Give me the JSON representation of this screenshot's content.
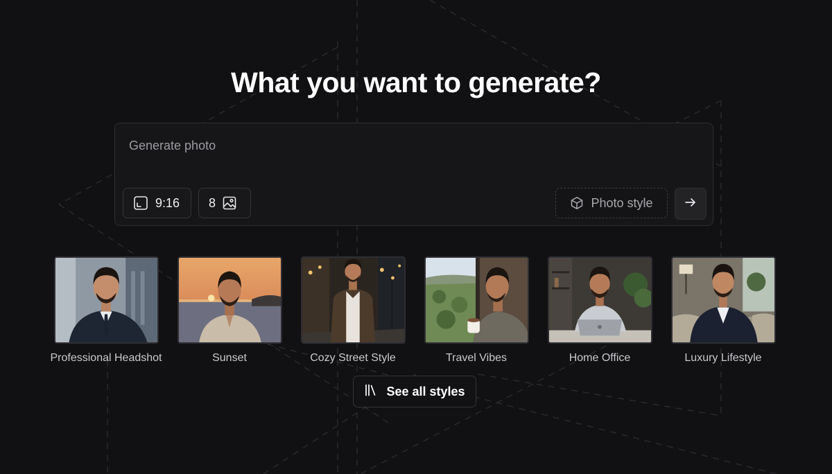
{
  "heading": "What you want to generate?",
  "prompt": {
    "placeholder": "Generate photo",
    "value": ""
  },
  "controls": {
    "aspect_ratio": "9:16",
    "image_count": "8",
    "style_button": "Photo style"
  },
  "styles": [
    {
      "label": "Professional Headshot",
      "scene": "office-city"
    },
    {
      "label": "Sunset",
      "scene": "beach-sunset"
    },
    {
      "label": "Cozy Street Style",
      "scene": "night-street"
    },
    {
      "label": "Travel Vibes",
      "scene": "train-window"
    },
    {
      "label": "Home Office",
      "scene": "desk-laptop"
    },
    {
      "label": "Luxury Lifestyle",
      "scene": "lounge"
    }
  ],
  "see_all_label": "See all styles",
  "colors": {
    "background": "#111113",
    "card_border": "#2e2e33",
    "text_primary": "#ffffff",
    "text_muted": "#9b9ba1"
  },
  "icons": {
    "aspect_ratio": "crop-frame-icon",
    "image_count": "image-icon",
    "photo_style": "cube-icon",
    "send": "arrow-right-icon",
    "see_all": "library-icon"
  }
}
